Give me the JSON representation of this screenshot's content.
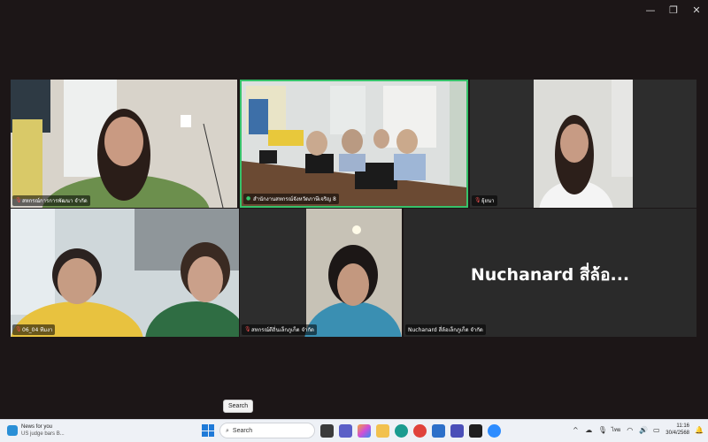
{
  "window": {
    "minimize": "—",
    "restore": "❐",
    "close": "✕"
  },
  "tiles": [
    {
      "name": "สหกรณ์การการพัฒนา จำกัด",
      "mic": "muted"
    },
    {
      "name": "สำนักงานสหกรณ์จังหวัดภาษีเจริญ 8",
      "mic": "active"
    },
    {
      "name": "ยุ้ยนา",
      "mic": "muted"
    },
    {
      "name": "06_04 ทีมงา",
      "mic": "muted"
    },
    {
      "name": "สหกรณ์ดีถิ่นเล็กภูเก็ต จำกัด",
      "mic": "muted"
    },
    {
      "name": "Nuchanard สี่ล้อเล็กภูเก็ต จำกัด",
      "mic": "muted",
      "display_name": "Nuchanard สี่ล้อ..."
    }
  ],
  "tooltip": "Search",
  "taskbar": {
    "news_title": "News for you",
    "news_sub": "US judge bars B...",
    "search_label": "Search",
    "language": "ไทย",
    "time": "11:16",
    "date": "30/4/2568"
  },
  "colors": {
    "active_speaker": "#36c26a",
    "background": "#1c1617"
  }
}
